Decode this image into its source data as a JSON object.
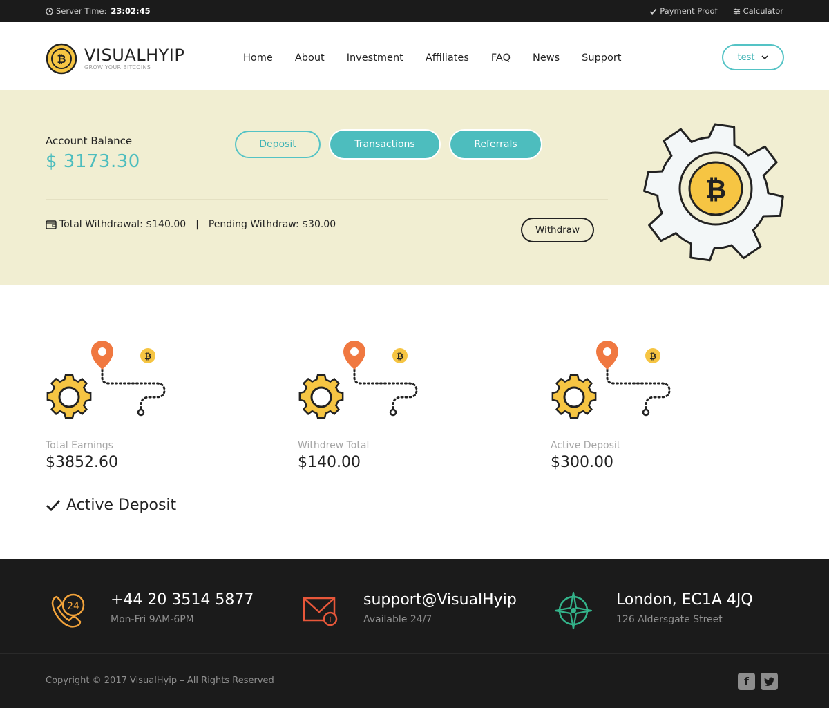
{
  "topbar": {
    "server_time_label": "Server Time:",
    "server_time_value": "23:02:45",
    "payment_proof": "Payment Proof",
    "calculator": "Calculator"
  },
  "logo": {
    "brand": "VISUALHYIP",
    "tagline": "GROW YOUR BITCOINS"
  },
  "nav": [
    "Home",
    "About",
    "Investment",
    "Affiliates",
    "FAQ",
    "News",
    "Support"
  ],
  "user_menu": {
    "label": "test"
  },
  "account": {
    "balance_label": "Account Balance",
    "balance_value": "$ 3173.30",
    "buttons": {
      "deposit": "Deposit",
      "transactions": "Transactions",
      "referrals": "Referrals",
      "withdraw": "Withdraw"
    },
    "total_withdrawal": "Total Withdrawal: $140.00",
    "separator": "|",
    "pending_withdraw": "Pending Withdraw: $30.00"
  },
  "stats": [
    {
      "label": "Total Earnings",
      "value": "$3852.60"
    },
    {
      "label": "Withdrew Total",
      "value": "$140.00"
    },
    {
      "label": "Active Deposit",
      "value": "$300.00"
    }
  ],
  "active_deposit_heading": "Active Deposit",
  "footer": {
    "phone": {
      "title": "+44 20 3514 5877",
      "sub": "Mon-Fri 9AM-6PM",
      "icon": "phone-24-icon"
    },
    "email": {
      "title": "support@VisualHyip",
      "sub": "Available 24/7",
      "icon": "mail-icon"
    },
    "address": {
      "title": "London, EC1A 4JQ",
      "sub": "126 Aldersgate Street",
      "icon": "compass-icon"
    },
    "copyright": "Copyright © 2017 VisualHyip – All Rights Reserved"
  },
  "colors": {
    "accent": "#4dbdbe",
    "banner": "#f1eed2",
    "coin": "#f6c543",
    "pin": "#f07840",
    "dark": "#1b1b1b"
  }
}
